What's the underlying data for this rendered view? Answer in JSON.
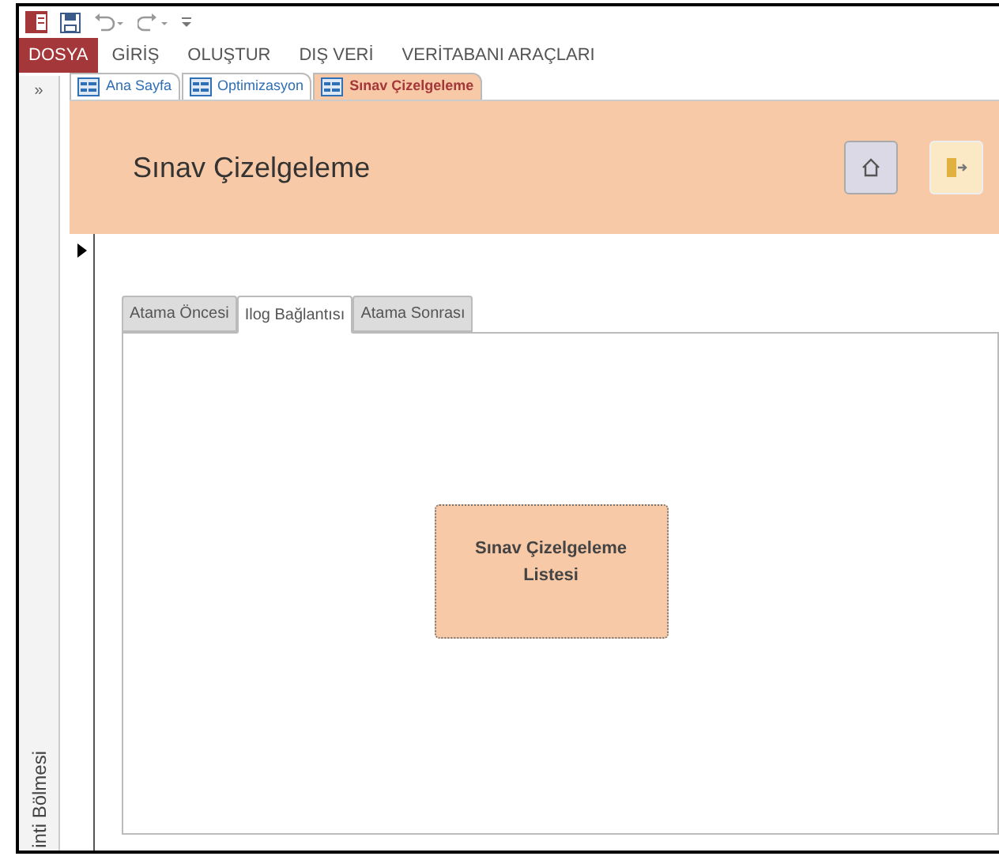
{
  "ribbon_tabs": [
    {
      "label": "DOSYA",
      "kind": "file"
    },
    {
      "label": "GİRİŞ",
      "kind": "tab"
    },
    {
      "label": "OLUŞTUR",
      "kind": "tab"
    },
    {
      "label": "DIŞ VERİ",
      "kind": "tab"
    },
    {
      "label": "VERİTABANI ARAÇLARI",
      "kind": "tab"
    }
  ],
  "nav_pane": {
    "toggle": "»",
    "title": "inti Bölmesi"
  },
  "document_tabs": [
    {
      "label": "Ana Sayfa",
      "selected": false
    },
    {
      "label": "Optimizasyon",
      "selected": false
    },
    {
      "label": "Sınav Çizelgeleme",
      "selected": true
    }
  ],
  "form": {
    "title": "Sınav Çizelgeleme",
    "tabs": [
      {
        "label": "Atama Öncesi",
        "selected": false
      },
      {
        "label": "Ilog Bağlantısı",
        "selected": true
      },
      {
        "label": "Atama Sonrası",
        "selected": false
      }
    ],
    "button": "Sınav Çizelgeleme Listesi"
  }
}
